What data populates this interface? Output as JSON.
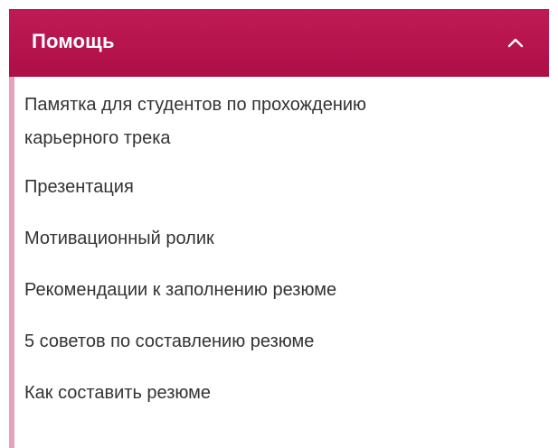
{
  "header": {
    "title": "Помощь",
    "toggle_icon": "chevron-up-icon"
  },
  "colors": {
    "header_bg": "#b3134b",
    "accent_bar": "#e3a4bb",
    "link_text": "#333333"
  },
  "links": [
    {
      "line1": "Памятка для студентов по прохождению",
      "line2": "карьерного трека"
    },
    {
      "label": "Презентация"
    },
    {
      "label": "Мотивационный ролик"
    },
    {
      "label": "Рекомендации к заполнению резюме"
    },
    {
      "label": "5 советов по составлению резюме"
    },
    {
      "label": "Как составить резюме"
    }
  ]
}
